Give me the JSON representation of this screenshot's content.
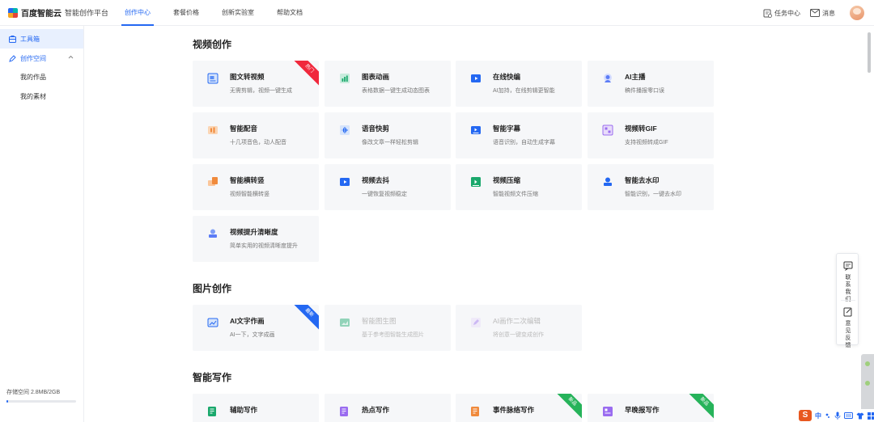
{
  "header": {
    "logo_text": "百度智能云",
    "logo_sub": "智能创作平台",
    "nav": [
      {
        "label": "创作中心",
        "active": true
      },
      {
        "label": "套餐价格",
        "active": false
      },
      {
        "label": "创新实验室",
        "active": false
      },
      {
        "label": "帮助文档",
        "active": false
      }
    ],
    "task_center": "任务中心",
    "messages": "消息"
  },
  "sidebar": {
    "toolbox": "工具箱",
    "creation_space": "创作空间",
    "my_works": "我的作品",
    "my_materials": "我的素材",
    "storage_label": "存储空间 2.8MB/2GB",
    "storage_fraction": 0.0014
  },
  "sections": {
    "video": "视频创作",
    "image": "图片创作",
    "writing": "智能写作"
  },
  "video_cards": [
    {
      "title": "图文转视频",
      "desc": "无需剪辑，视频一键生成",
      "icon": "image-text-icon",
      "badge": "热门"
    },
    {
      "title": "图表动画",
      "desc": "表格数据一键生成动态图表",
      "icon": "chart-icon",
      "badge": ""
    },
    {
      "title": "在线快编",
      "desc": "AI加持，在线剪辑更智能",
      "icon": "play-icon",
      "badge": ""
    },
    {
      "title": "AI主播",
      "desc": "稿件播报零口误",
      "icon": "ai-anchor-icon",
      "badge": ""
    },
    {
      "title": "智能配音",
      "desc": "十几项音色，动人配音",
      "icon": "dubbing-icon",
      "badge": ""
    },
    {
      "title": "语音快剪",
      "desc": "像改文章一样轻松剪辑",
      "icon": "audio-wave-icon",
      "badge": ""
    },
    {
      "title": "智能字幕",
      "desc": "语音识别，自动生成字幕",
      "icon": "subtitle-icon",
      "badge": ""
    },
    {
      "title": "视频转GIF",
      "desc": "支持视频转成GIF",
      "icon": "gif-icon",
      "badge": ""
    },
    {
      "title": "智能横转竖",
      "desc": "视频智能横转竖",
      "icon": "rotate-icon",
      "badge": ""
    },
    {
      "title": "视频去抖",
      "desc": "一键恢复视频稳定",
      "icon": "stabilize-icon",
      "badge": ""
    },
    {
      "title": "视频压缩",
      "desc": "智能视频文件压缩",
      "icon": "compress-icon",
      "badge": ""
    },
    {
      "title": "智能去水印",
      "desc": "智能识别，一键去水印",
      "icon": "watermark-icon",
      "badge": ""
    },
    {
      "title": "视频提升清晰度",
      "desc": "简单实用的视频清晰度提升",
      "icon": "enhance-icon",
      "badge": ""
    }
  ],
  "image_cards": [
    {
      "title": "AI文字作画",
      "desc": "AI一下，文字成画",
      "icon": "ai-paint-icon",
      "badge": "最新",
      "disabled": false
    },
    {
      "title": "智能图生图",
      "desc": "基于参考图智能生成图片",
      "icon": "image-gen-icon",
      "badge": "",
      "disabled": true
    },
    {
      "title": "AI画作二次编辑",
      "desc": "将创意一键变成创作",
      "icon": "edit-paint-icon",
      "badge": "",
      "disabled": true
    }
  ],
  "writing_cards": [
    {
      "title": "辅助写作",
      "desc": "",
      "icon": "assist-write-icon",
      "badge": ""
    },
    {
      "title": "热点写作",
      "desc": "",
      "icon": "hot-write-icon",
      "badge": ""
    },
    {
      "title": "事件脉络写作",
      "desc": "",
      "icon": "timeline-write-icon",
      "badge": "新品"
    },
    {
      "title": "早晚报写作",
      "desc": "",
      "icon": "daily-report-icon",
      "badge": "新品"
    }
  ],
  "float": {
    "contact": "联系我们",
    "feedback": "意见反馈"
  },
  "ime": {
    "logo": "S",
    "mode": "中"
  },
  "colors": {
    "accent": "#2468f2",
    "badge_hot": "#f0283c",
    "badge_new": "#2468f2",
    "badge_product": "#26b35a"
  }
}
